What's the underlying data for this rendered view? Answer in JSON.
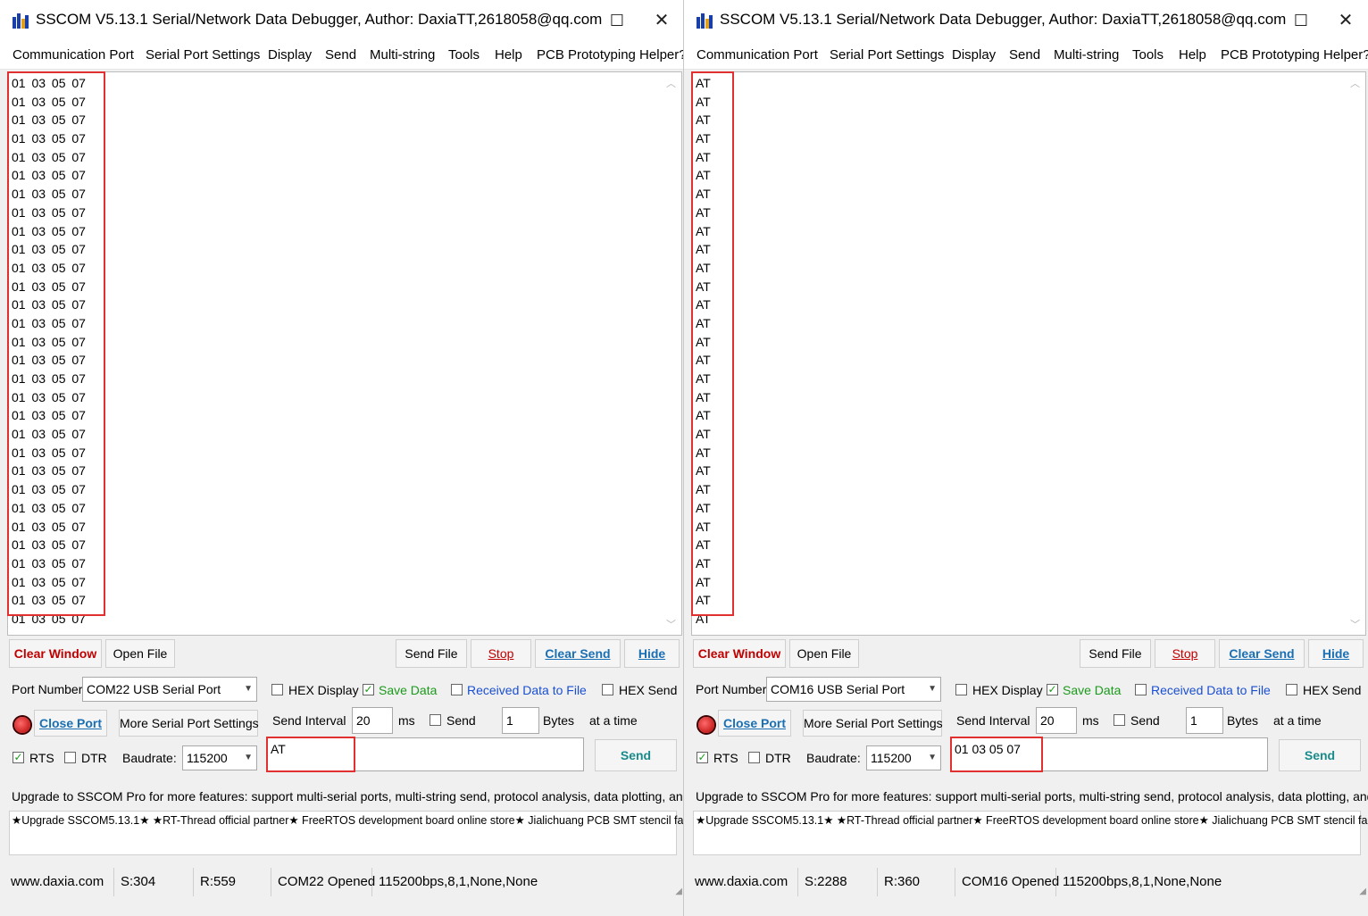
{
  "windows": [
    {
      "title": "SSCOM V5.13.1 Serial/Network Data Debugger, Author: DaxiaTT,2618058@qq.com",
      "menu": [
        "Communication Port",
        "Serial Port Settings",
        "Display",
        "Send",
        "Multi-string",
        "Tools",
        "Help",
        "PCB Prototyping Helper?"
      ],
      "received_lines": [
        "01 03 05 07",
        "01 03 05 07",
        "01 03 05 07",
        "01 03 05 07",
        "01 03 05 07",
        "01 03 05 07",
        "01 03 05 07",
        "01 03 05 07",
        "01 03 05 07",
        "01 03 05 07",
        "01 03 05 07",
        "01 03 05 07",
        "01 03 05 07",
        "01 03 05 07",
        "01 03 05 07",
        "01 03 05 07",
        "01 03 05 07",
        "01 03 05 07",
        "01 03 05 07",
        "01 03 05 07",
        "01 03 05 07",
        "01 03 05 07",
        "01 03 05 07",
        "01 03 05 07",
        "01 03 05 07",
        "01 03 05 07",
        "01 03 05 07",
        "01 03 05 07",
        "01 03 05 07",
        "01 03 05 07"
      ],
      "buttons": {
        "clear_window": "Clear Window",
        "open_file": "Open File",
        "send_file": "Send File",
        "stop": "Stop",
        "clear_send": "Clear Send",
        "hide": "Hide"
      },
      "port_number_label": "Port Number",
      "port": "COM22 USB Serial Port",
      "hex_display": "HEX Display",
      "save_data": "Save Data",
      "received_to_file": "Received Data to File",
      "hex_send": "HEX Send",
      "close_port": "Close Port",
      "more_settings": "More Serial Port Settings",
      "send_interval_label": "Send Interval",
      "send_interval": "20",
      "ms": "ms",
      "send_chk": "Send",
      "bytes_value": "1",
      "bytes_label": "Bytes",
      "at_a_time": "at a time",
      "rts": "RTS",
      "dtr": "DTR",
      "baudrate_label": "Baudrate:",
      "baudrate": "115200",
      "send_text": "AT",
      "send_button": "Send",
      "promo": "Upgrade to SSCOM Pro for more features: support multi-serial ports, multi-string send, protocol analysis, data plotting, and more!",
      "ticker": "★Upgrade SSCOM5.13.1★ ★RT-Thread official partner★ FreeRTOS development board online store★ Jialichuang PCB SMT stencil factory",
      "status": {
        "site": "www.daxia.com",
        "sent": "S:304",
        "recv": "R:559",
        "state": "COM22 Opened",
        "params": "115200bps,8,1,None,None"
      }
    },
    {
      "title": "SSCOM V5.13.1 Serial/Network Data Debugger, Author: DaxiaTT,2618058@qq.com",
      "menu": [
        "Communication Port",
        "Serial Port Settings",
        "Display",
        "Send",
        "Multi-string",
        "Tools",
        "Help",
        "PCB Prototyping Helper?"
      ],
      "received_lines": [
        "AT",
        "AT",
        "AT",
        "AT",
        "AT",
        "AT",
        "AT",
        "AT",
        "AT",
        "AT",
        "AT",
        "AT",
        "AT",
        "AT",
        "AT",
        "AT",
        "AT",
        "AT",
        "AT",
        "AT",
        "AT",
        "AT",
        "AT",
        "AT",
        "AT",
        "AT",
        "AT",
        "AT",
        "AT",
        "AT"
      ],
      "buttons": {
        "clear_window": "Clear Window",
        "open_file": "Open File",
        "send_file": "Send File",
        "stop": "Stop",
        "clear_send": "Clear Send",
        "hide": "Hide"
      },
      "port_number_label": "Port Number",
      "port": "COM16 USB Serial Port",
      "hex_display": "HEX Display",
      "save_data": "Save Data",
      "received_to_file": "Received Data to File",
      "hex_send": "HEX Send",
      "close_port": "Close Port",
      "more_settings": "More Serial Port Settings",
      "send_interval_label": "Send Interval",
      "send_interval": "20",
      "ms": "ms",
      "send_chk": "Send",
      "bytes_value": "1",
      "bytes_label": "Bytes",
      "at_a_time": "at a time",
      "rts": "RTS",
      "dtr": "DTR",
      "baudrate_label": "Baudrate:",
      "baudrate": "115200",
      "send_text": "01 03 05 07",
      "send_button": "Send",
      "promo": "Upgrade to SSCOM Pro for more features: support multi-serial ports, multi-string send, protocol analysis, data plotting, and more!",
      "ticker": "★Upgrade SSCOM5.13.1★ ★RT-Thread official partner★ FreeRTOS development board online store★ Jialichuang PCB SMT stencil factory",
      "status": {
        "site": "www.daxia.com",
        "sent": "S:2288",
        "recv": "R:360",
        "state": "COM16 Opened",
        "params": "115200bps,8,1,None,None"
      }
    }
  ],
  "colors": {
    "highlight": "#e03030",
    "link": "#1a6fb3",
    "green": "#1a9a1a",
    "blue": "#1a4fd0",
    "red": "#c00000"
  }
}
